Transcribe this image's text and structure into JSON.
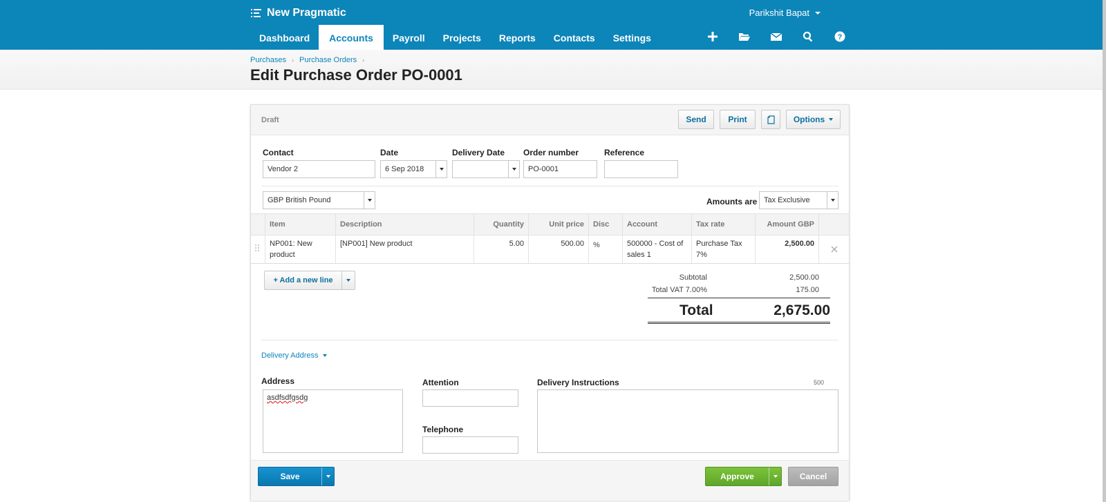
{
  "app": {
    "org_name": "New Pragmatic",
    "user_name": "Parikshit Bapat",
    "menu_icon": "list-icon"
  },
  "nav": {
    "tabs": [
      "Dashboard",
      "Accounts",
      "Payroll",
      "Projects",
      "Reports",
      "Contacts",
      "Settings"
    ],
    "active": "Accounts",
    "icons": [
      "plus-icon",
      "folder-icon",
      "mail-icon",
      "search-icon",
      "help-icon"
    ]
  },
  "breadcrumb": [
    "Purchases",
    "Purchase Orders"
  ],
  "page_title": "Edit Purchase Order PO-0001",
  "card": {
    "status": "Draft",
    "send_label": "Send",
    "print_label": "Print",
    "copy_icon": "copy-icon",
    "options_label": "Options"
  },
  "form": {
    "contact_label": "Contact",
    "contact_value": "Vendor 2",
    "date_label": "Date",
    "date_value": "6 Sep 2018",
    "delivery_date_label": "Delivery Date",
    "delivery_date_value": "",
    "order_number_label": "Order number",
    "order_number_value": "PO-0001",
    "reference_label": "Reference",
    "reference_value": "",
    "currency_value": "GBP British Pound",
    "amounts_are_label": "Amounts are",
    "amounts_are_value": "Tax Exclusive"
  },
  "grid": {
    "headers": [
      "Item",
      "Description",
      "Quantity",
      "Unit price",
      "Disc %",
      "Account",
      "Tax rate",
      "Amount GBP"
    ],
    "rows": [
      {
        "item": "NP001: New product",
        "description": "[NP001] New product",
        "quantity": "5.00",
        "unit_price": "500.00",
        "disc": "",
        "account": "500000 - Cost of sales 1",
        "tax_rate": "Purchase Tax 7%",
        "amount": "2,500.00"
      }
    ],
    "add_line_label": "+ Add a new line"
  },
  "totals": {
    "subtotal_label": "Subtotal",
    "subtotal_value": "2,500.00",
    "vat_label": "Total VAT 7.00%",
    "vat_value": "175.00",
    "total_label": "Total",
    "total_value": "2,675.00"
  },
  "delivery": {
    "toggle_label": "Delivery Address",
    "address_label": "Address",
    "address_value": "asdfsdfgsdg",
    "attention_label": "Attention",
    "attention_value": "",
    "telephone_label": "Telephone",
    "telephone_value": "",
    "instructions_label": "Delivery Instructions",
    "instructions_limit": "500",
    "instructions_value": ""
  },
  "footer": {
    "save_label": "Save",
    "approve_label": "Approve",
    "cancel_label": "Cancel"
  },
  "colors": {
    "brand_blue": "#0c85b9",
    "approve_green": "#6db532",
    "cancel_grey": "#aaaaaa"
  }
}
